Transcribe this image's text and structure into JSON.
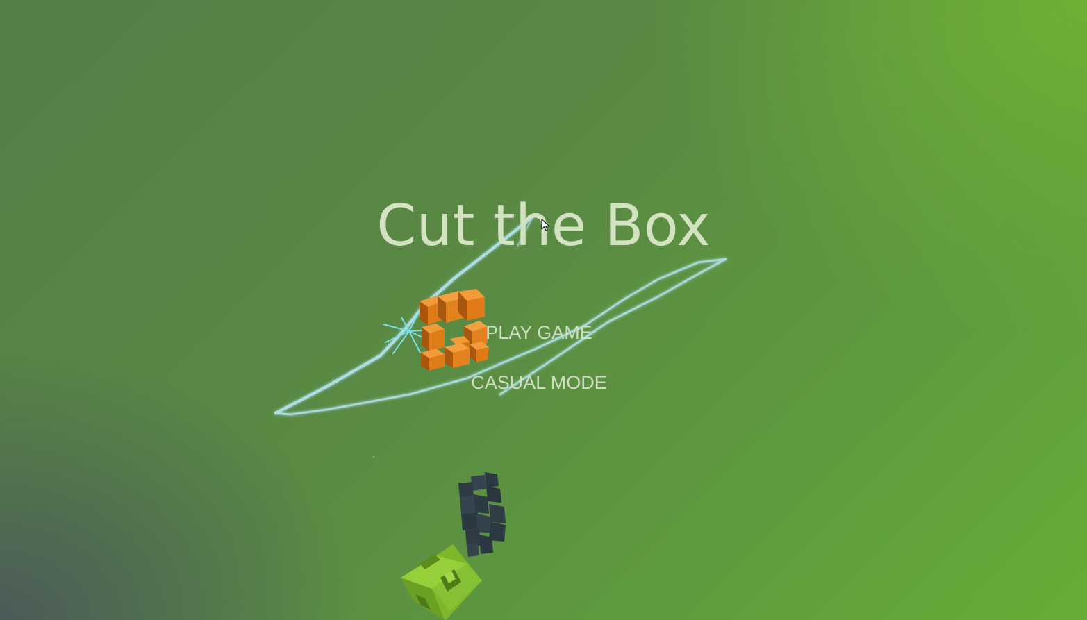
{
  "game": {
    "title": "Cut the Box",
    "menu": {
      "play_label": "PLAY GAME",
      "casual_label": "CASUAL MODE"
    }
  },
  "colors": {
    "title_text": "#d3e2c1",
    "menu_text": "#cfdcc2",
    "slash_trail": "#a9dbe6",
    "orange_box": "#e2821e",
    "green_box": "#8cc63a",
    "dark_fragments": "#2f3b44"
  },
  "icons": {
    "cursor": "mouse-pointer-icon"
  }
}
